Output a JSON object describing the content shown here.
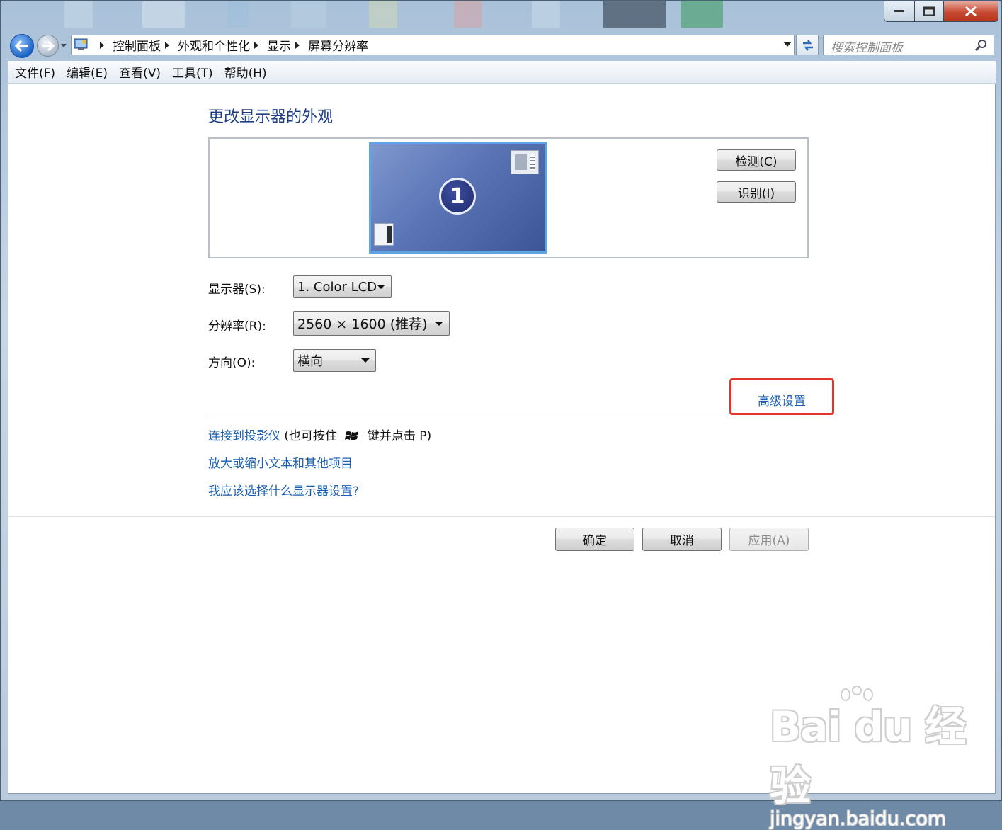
{
  "address_bar": {
    "crumbs": [
      "控制面板",
      "外观和个性化",
      "显示",
      "屏幕分辨率"
    ]
  },
  "search": {
    "placeholder": "搜索控制面板"
  },
  "menubar": {
    "items": [
      "文件(F)",
      "编辑(E)",
      "查看(V)",
      "工具(T)",
      "帮助(H)"
    ]
  },
  "page": {
    "title": "更改显示器的外观",
    "monitor_number": "1",
    "detect_label": "检测(C)",
    "identify_label": "识别(I)",
    "display_label": "显示器(S):",
    "display_value": "1. Color LCD",
    "resolution_label": "分辨率(R):",
    "resolution_value": "2560 × 1600 (推荐)",
    "orientation_label": "方向(O):",
    "orientation_value": "横向",
    "advanced_link": "高级设置",
    "projector_link": "连接到投影仪",
    "projector_note_a": "(也可按住",
    "projector_note_b": "键并点击 P)",
    "scale_link": "放大或缩小文本和其他项目",
    "help_link": "我应该选择什么显示器设置?"
  },
  "footer": {
    "ok_label": "确定",
    "cancel_label": "取消",
    "apply_label": "应用(A)"
  },
  "watermark": {
    "logo": "Bai  du 经验",
    "url": "jingyan.baidu.com"
  },
  "colors": {
    "link": "#1a5fb4",
    "title": "#1e3f86",
    "highlight_box": "#e3342a",
    "close_button": "#c84a33"
  }
}
